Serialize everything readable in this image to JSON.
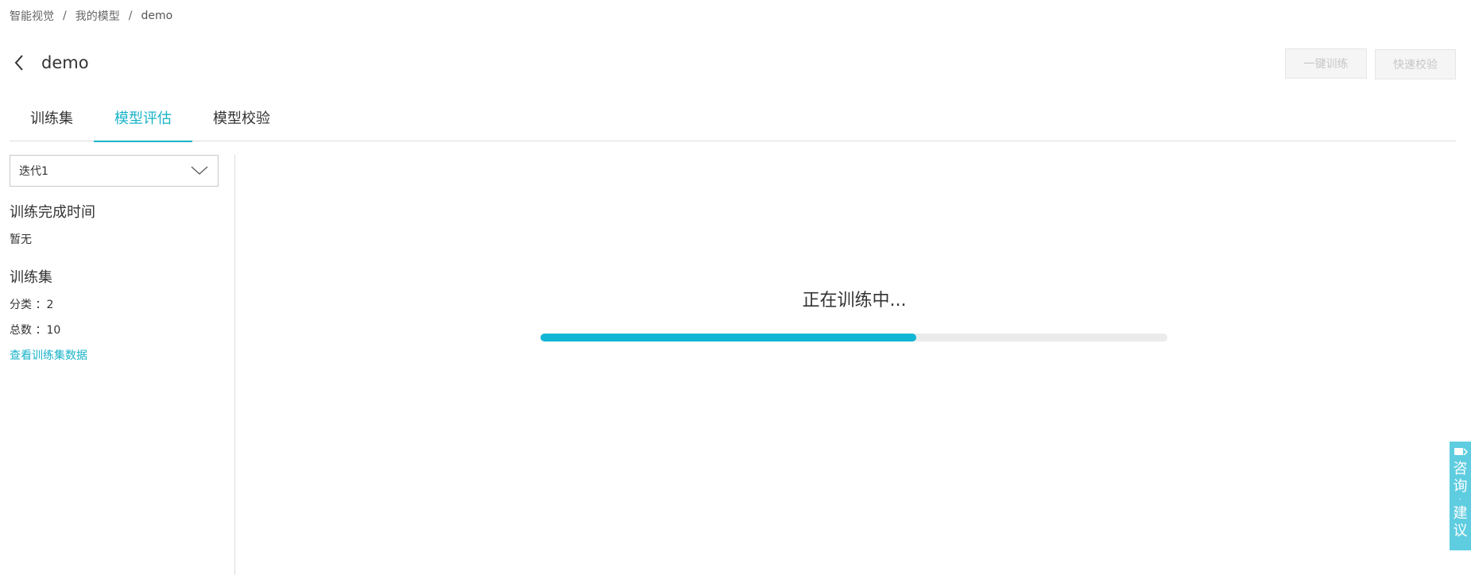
{
  "breadcrumb": {
    "items": [
      "智能视觉",
      "我的模型",
      "demo"
    ],
    "separator": "/"
  },
  "header": {
    "title": "demo",
    "back_icon": "chevron-left-icon",
    "train_button": "一键训练",
    "verify_button": "快速校验"
  },
  "tabs": [
    {
      "label": "训练集",
      "active": false
    },
    {
      "label": "模型评估",
      "active": true
    },
    {
      "label": "模型校验",
      "active": false
    }
  ],
  "sidebar": {
    "iteration_select": "迭代1",
    "completion_time_title": "训练完成时间",
    "completion_time_value": "暂无",
    "dataset_title": "训练集",
    "category_line": "分类 ：2",
    "total_line": "总数 ：10",
    "view_data_link": "查看训练集数据"
  },
  "main": {
    "status_text": "正在训练中...",
    "progress_fraction": 0.6
  },
  "consult": {
    "chars": [
      "咨",
      "询",
      "·",
      "建",
      "议"
    ]
  },
  "colors": {
    "accent": "#1ab3c9",
    "progress": "#12b6d4",
    "consult_bg": "#5fcde0"
  }
}
